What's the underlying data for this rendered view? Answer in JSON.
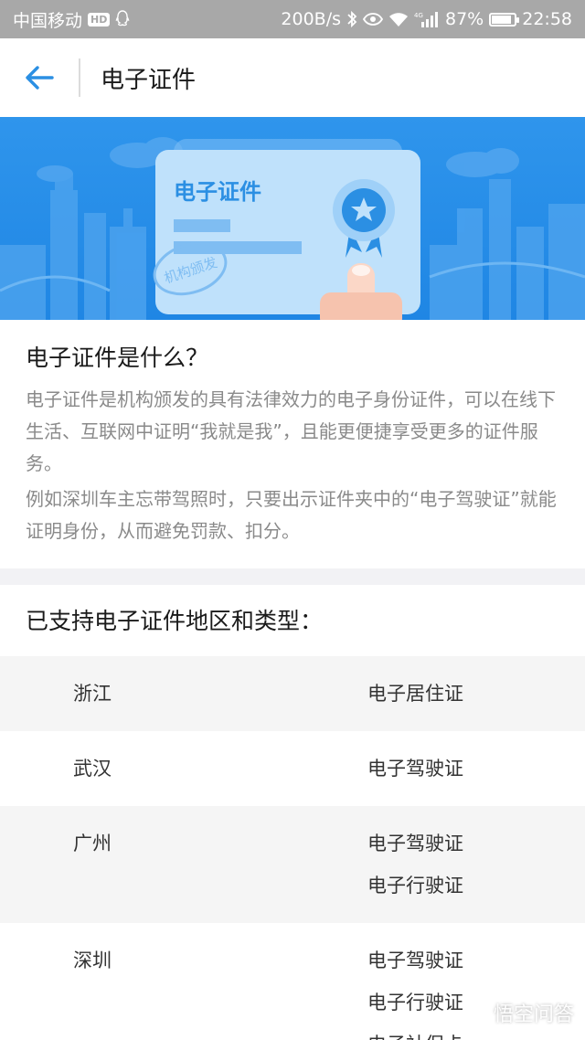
{
  "status_bar": {
    "carrier": "中国移动",
    "hd": "HD",
    "speed": "200B/s",
    "battery": "87%",
    "battery_level": 0.87,
    "time": "22:58",
    "signal": "4G"
  },
  "nav": {
    "title": "电子证件"
  },
  "banner": {
    "card_title": "电子证件",
    "stamp_text": "机构颁发"
  },
  "info": {
    "title": "电子证件是什么？",
    "paragraph1": "电子证件是机构颁发的具有法律效力的电子身份证件，可以在线下生活、互联网中证明“我就是我”，且能更便捷享受更多的证件服务。",
    "paragraph2": "例如深圳车主忘带驾照时，只要出示证件夹中的“电子驾驶证”就能证明身份，从而避免罚款、扣分。"
  },
  "regions": {
    "title": "已支持电子证件地区和类型：",
    "rows": [
      {
        "region": "浙江",
        "types": [
          "电子居住证"
        ]
      },
      {
        "region": "武汉",
        "types": [
          "电子驾驶证"
        ]
      },
      {
        "region": "广州",
        "types": [
          "电子驾驶证",
          "电子行驶证"
        ]
      },
      {
        "region": "深圳",
        "types": [
          "电子驾驶证",
          "电子行驶证",
          "电子社保卡"
        ]
      }
    ]
  },
  "watermark": {
    "text": "悟空问答"
  },
  "colors": {
    "accent": "#2b8fe3",
    "banner_blue": "#2f95ec",
    "status_bar": "#a8a8a8"
  }
}
